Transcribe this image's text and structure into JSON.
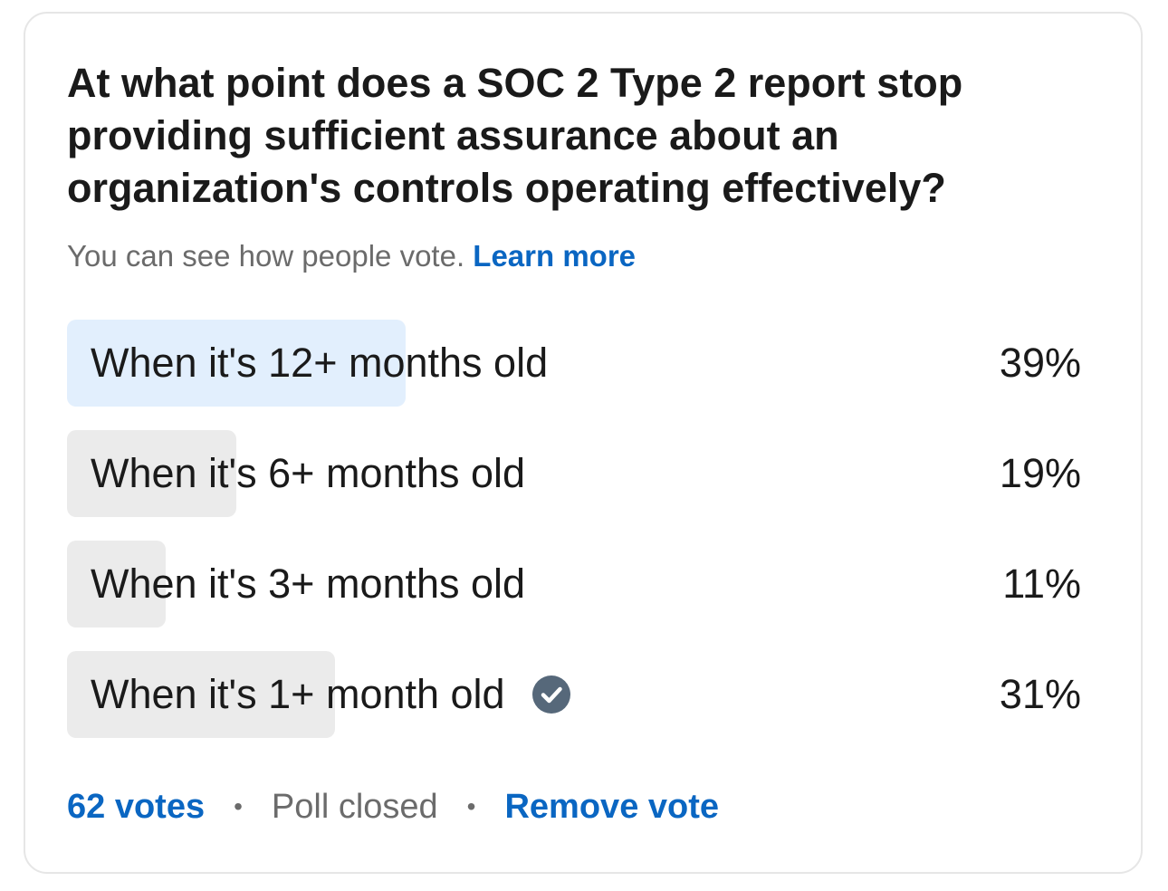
{
  "poll": {
    "question": "At what point does a SOC 2 Type 2 report stop providing sufficient assurance about an organization's controls operating effectively?",
    "visibility_text": "You can see how people vote.",
    "learn_more_label": "Learn more",
    "options": [
      {
        "label": "When it's 12+ months old",
        "percent_label": "39%",
        "percent": 39,
        "leading": true,
        "my_vote": false
      },
      {
        "label": "When it's 6+ months old",
        "percent_label": "19%",
        "percent": 19,
        "leading": false,
        "my_vote": false
      },
      {
        "label": "When it's 3+ months old",
        "percent_label": "11%",
        "percent": 11,
        "leading": false,
        "my_vote": false
      },
      {
        "label": "When it's 1+ month old",
        "percent_label": "31%",
        "percent": 31,
        "leading": false,
        "my_vote": true
      }
    ],
    "votes_label": "62 votes",
    "status_label": "Poll closed",
    "remove_vote_label": "Remove vote",
    "separator": "•"
  },
  "colors": {
    "accent": "#0a66c2",
    "leading_fill": "#e2effd",
    "bar_fill": "#ebebeb",
    "check_icon": "#56687a",
    "muted_text": "#6b6b6b"
  },
  "icons": {
    "my_vote": "check-circle-icon"
  }
}
